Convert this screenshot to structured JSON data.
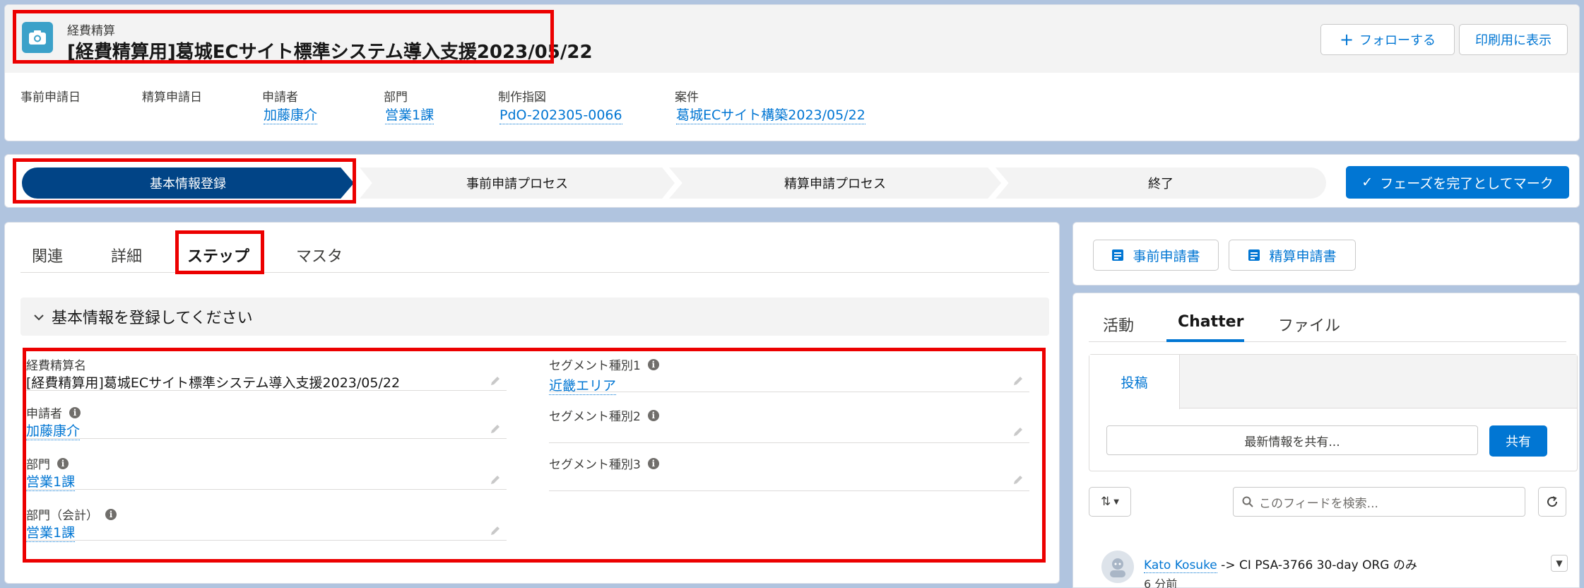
{
  "header": {
    "record_type": "経費精算",
    "title": "[経費精算用]葛城ECサイト標準システム導入支援2023/05/22",
    "follow_label": "フォローする",
    "print_label": "印刷用に表示",
    "highlights": [
      {
        "label": "事前申請日",
        "value": ""
      },
      {
        "label": "精算申請日",
        "value": ""
      },
      {
        "label": "申請者",
        "value": "加藤康介"
      },
      {
        "label": "部門",
        "value": "営業1課"
      },
      {
        "label": "制作指図",
        "value": "PdO-202305-0066"
      },
      {
        "label": "案件",
        "value": "葛城ECサイト構築2023/05/22"
      }
    ]
  },
  "path": {
    "steps": [
      "基本情報登録",
      "事前申請プロセス",
      "精算申請プロセス",
      "終了"
    ],
    "complete_label": "フェーズを完了としてマーク"
  },
  "main": {
    "tabs": [
      "関連",
      "詳細",
      "ステップ",
      "マスタ"
    ],
    "active_tab": "ステップ",
    "section_title": "基本情報を登録してください",
    "fields_left": [
      {
        "label": "経費精算名",
        "value": "[経費精算用]葛城ECサイト標準システム導入支援2023/05/22"
      },
      {
        "label": "申請者",
        "value": "加藤康介"
      },
      {
        "label": "部門",
        "value": "営業1課"
      },
      {
        "label": "部門（会計）",
        "value": "営業1課"
      }
    ],
    "fields_right": [
      {
        "label": "セグメント種別1",
        "value": "近畿エリア"
      },
      {
        "label": "セグメント種別2",
        "value": ""
      },
      {
        "label": "セグメント種別3",
        "value": ""
      }
    ]
  },
  "docs": {
    "pre_application": "事前申請書",
    "settlement_application": "精算申請書"
  },
  "activity": {
    "tabs": [
      "活動",
      "Chatter",
      "ファイル"
    ],
    "active_tab": "Chatter",
    "post_tab": "投稿",
    "share_placeholder": "最新情報を共有...",
    "share_button": "共有",
    "search_placeholder": "このフィードを検索...",
    "feed": {
      "author": "Kato Kosuke",
      "target": " -> CI PSA-3766 30-day ORG のみ",
      "time": "6 分前"
    }
  },
  "colors": {
    "brand": "#0176d3",
    "path_active": "#014486",
    "highlight_box": "#ec0000"
  }
}
